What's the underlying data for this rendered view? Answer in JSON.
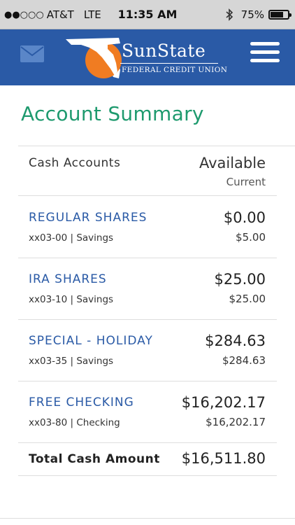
{
  "status_bar": {
    "signal": "●●○○○",
    "carrier": "AT&T",
    "network": "LTE",
    "time": "11:35 AM",
    "battery": "75%",
    "battery_level": 0.75
  },
  "header": {
    "brand_main": "SunState",
    "brand_sub": "FEDERAL CREDIT UNION",
    "brand_color": "#2a5aa6",
    "accent_orange": "#f07c22"
  },
  "page": {
    "title": "Account Summary",
    "title_color": "#1e9a6e"
  },
  "table": {
    "section_label": "Cash Accounts",
    "col_available": "Available",
    "col_current": "Current",
    "accounts": [
      {
        "name": "REGULAR SHARES",
        "number": "xx03-00 | Savings",
        "available": "$0.00",
        "current": "$5.00"
      },
      {
        "name": "IRA SHARES",
        "number": "xx03-10 | Savings",
        "available": "$25.00",
        "current": "$25.00"
      },
      {
        "name": "SPECIAL - HOLIDAY",
        "number": "xx03-35 | Savings",
        "available": "$284.63",
        "current": "$284.63"
      },
      {
        "name": "FREE CHECKING",
        "number": "xx03-80 | Checking",
        "available": "$16,202.17",
        "current": "$16,202.17"
      }
    ],
    "total_label": "Total Cash Amount",
    "total_value": "$16,511.80"
  }
}
